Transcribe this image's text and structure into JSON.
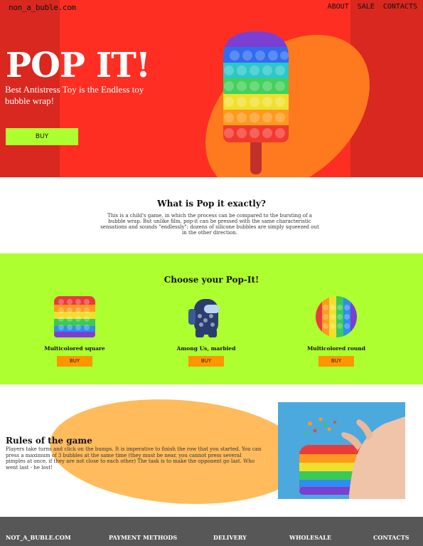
{
  "nav": {
    "logo": "non_a_buble.com",
    "items": [
      "ABOUT",
      "SALE",
      "CONTACTS"
    ]
  },
  "hero": {
    "title": "POP IT!",
    "subtitle": "Best Antistress Toy is the Endless toy bubble wrap!",
    "buy_label": "BUY"
  },
  "what": {
    "heading": "What is Pop it exactly?",
    "text": "This is a child's game, in which the process can be compared to the bursting of a bubble wrap. But unlike film, pop-it can be pressed with the same characteristic sensations and sounds \"endlessly\": dozens of silicone bubbles are simply squeezed out in the other direction."
  },
  "choose": {
    "heading": "Choose your Pop-It!",
    "products": [
      {
        "name": "Multicolored square",
        "buy_label": "BUY",
        "icon": "square-popit"
      },
      {
        "name": "Among Us, marbled",
        "buy_label": "BUY",
        "icon": "amongus-popit"
      },
      {
        "name": "Multicolored round",
        "buy_label": "BUY",
        "icon": "round-popit"
      }
    ]
  },
  "rules": {
    "heading": "Rules of the game",
    "text": "Players take turns and click on the bumps. It is imperative to finish the row that you started. You can press a maximum of 3 bubbles at the same time (they must be near, you cannot press several pimples at once, if they are not close to each other) The task is to make the opponent go last. Who went last - he lost!"
  },
  "footer": {
    "items": [
      "NOT_A_BUBLE.COM",
      "PAYMENT METHODS",
      "DELIVERY",
      "WHOLESALE",
      "CONTACTS"
    ]
  },
  "colors": {
    "hero_red": "#ff2e22",
    "hero_side": "#d8281f",
    "hero_blob": "#ff7a1e",
    "lime": "#adff2f",
    "buy_orange": "#ff9600",
    "rules_blob": "#ffbb5c",
    "footer": "#575757"
  }
}
